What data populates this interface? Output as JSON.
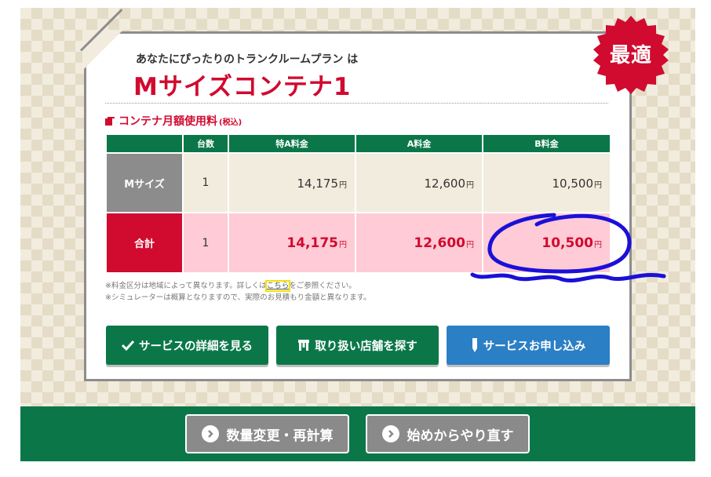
{
  "plan": {
    "subtitle": "あなたにぴったりのトランクルームプラン は",
    "title": "Mサイズコンテナ1",
    "badge": "最適"
  },
  "section": {
    "heading": "コンテナ月額使用料",
    "note": "(税込)"
  },
  "table": {
    "headers": [
      "",
      "台数",
      "特A料金",
      "A料金",
      "B料金"
    ],
    "yen": "円",
    "rows": [
      {
        "label": "Mサイズ",
        "count": "1",
        "prices": [
          "14,175",
          "12,600",
          "10,500"
        ]
      },
      {
        "label": "合計",
        "count": "1",
        "prices": [
          "14,175",
          "12,600",
          "10,500"
        ]
      }
    ]
  },
  "notes": {
    "line1_before": "※料金区分は地域によって異なります。詳しくは",
    "line1_link": "こちら",
    "line1_after": "をご参照ください。",
    "line2": "※シミュレーターは概算となりますので、実際のお見積もり金額と異なります。"
  },
  "buttons": {
    "details": "サービスの詳細を見る",
    "stores": "取り扱い店舗を探す",
    "apply": "サービスお申し込み"
  },
  "footer": {
    "recalc": "数量変更・再計算",
    "restart": "始めからやり直す"
  },
  "colors": {
    "brand_green": "#0b7749",
    "brand_red": "#d10a2f",
    "apply_blue": "#2b7fc4",
    "annotation_blue": "#1a10d8",
    "highlight_yellow": "#f2e100"
  },
  "icons": {
    "details": "check-icon",
    "stores": "store-icon",
    "apply": "pencil-icon",
    "footer": "chevron-circle-icon"
  }
}
